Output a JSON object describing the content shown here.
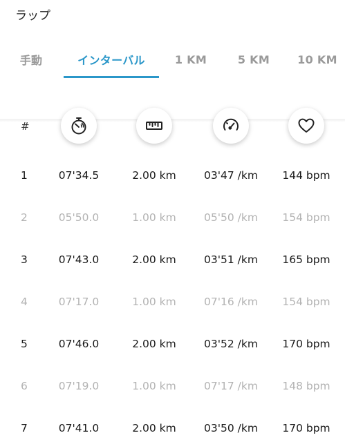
{
  "page_title": "ラップ",
  "tabs": [
    {
      "label": "手動",
      "active": false
    },
    {
      "label": "インターバル",
      "active": true
    },
    {
      "label": "1 KM",
      "active": false
    },
    {
      "label": "5 KM",
      "active": false
    },
    {
      "label": "10 KM",
      "active": false
    }
  ],
  "header": {
    "hash": "#",
    "icons": [
      "stopwatch-icon",
      "ruler-icon",
      "speedometer-icon",
      "heart-icon"
    ]
  },
  "accent_color": "#2b97c9",
  "laps": [
    {
      "num": "1",
      "time": "07'34.5",
      "distance": "2.00 km",
      "pace": "03'47 /km",
      "hr": "144 bpm",
      "dim": false
    },
    {
      "num": "2",
      "time": "05'50.0",
      "distance": "1.00 km",
      "pace": "05'50 /km",
      "hr": "154 bpm",
      "dim": true
    },
    {
      "num": "3",
      "time": "07'43.0",
      "distance": "2.00 km",
      "pace": "03'51 /km",
      "hr": "165 bpm",
      "dim": false
    },
    {
      "num": "4",
      "time": "07'17.0",
      "distance": "1.00 km",
      "pace": "07'16 /km",
      "hr": "154 bpm",
      "dim": true
    },
    {
      "num": "5",
      "time": "07'46.0",
      "distance": "2.00 km",
      "pace": "03'52 /km",
      "hr": "170 bpm",
      "dim": false
    },
    {
      "num": "6",
      "time": "07'19.0",
      "distance": "1.00 km",
      "pace": "07'17 /km",
      "hr": "148 bpm",
      "dim": true
    },
    {
      "num": "7",
      "time": "07'41.0",
      "distance": "2.00 km",
      "pace": "03'50 /km",
      "hr": "170 bpm",
      "dim": false
    }
  ]
}
